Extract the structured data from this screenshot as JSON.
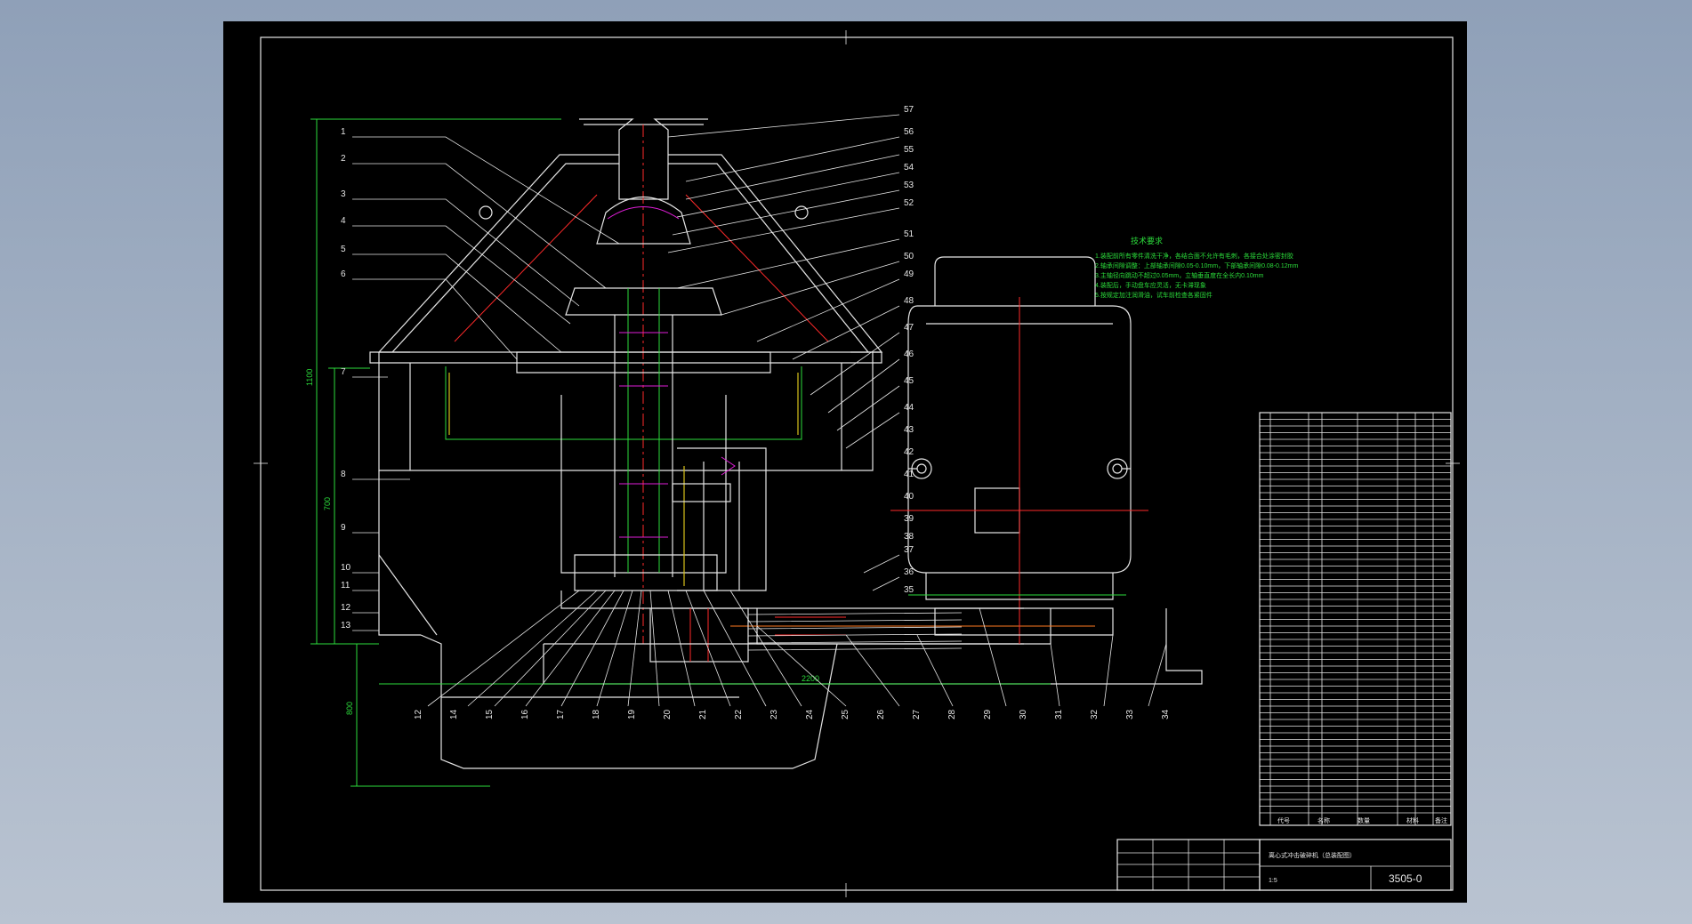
{
  "drawing": {
    "title": "",
    "drawing_number": "3505-0",
    "technical_notes_title": "技术要求",
    "technical_notes": [
      "1.装配前所有零件清洗干净，各结合面不允许有毛刺，各接合处涂密封胶",
      "2.轴承间隙调整：上部轴承间隙0.05-0.10mm，下部轴承间隙0.08-0.12mm",
      "3.主轴径向跳动不超过0.05mm，立轴垂直度在全长内0.10mm",
      "4.装配后，手动盘车应灵活，无卡滞现象",
      "5.按规定加注润滑油，试车前检查各紧固件"
    ],
    "callouts_left": [
      "1",
      "2",
      "3",
      "4",
      "5",
      "6",
      "7",
      "8",
      "9",
      "10",
      "11",
      "12",
      "13"
    ],
    "callouts_top_right": [
      "57",
      "56",
      "55",
      "54",
      "53",
      "52",
      "51",
      "50",
      "49",
      "48",
      "47",
      "46",
      "45",
      "44",
      "43",
      "42",
      "41",
      "40",
      "39",
      "38",
      "37",
      "36",
      "35"
    ],
    "callouts_bottom": [
      "12",
      "14",
      "15",
      "16",
      "17",
      "18",
      "19",
      "20",
      "21",
      "22",
      "23",
      "24",
      "25",
      "26",
      "27",
      "28",
      "29",
      "30",
      "31",
      "32",
      "33",
      "34"
    ],
    "dimension_labels": [
      "1100",
      "700",
      "2200",
      "800"
    ],
    "parts_list_rows": 60,
    "title_block": {
      "header_cols": [
        "代号",
        "名称",
        "数量",
        "材料",
        "备注"
      ],
      "name": "离心式冲击破碎机（总装配图）",
      "scale": "1:5",
      "number": "3505-0"
    }
  },
  "colors": {
    "background": "#000000",
    "outer_bg": "#a7b4c6",
    "line_white": "#e6e6e6",
    "line_green": "#2bdc3b",
    "line_red": "#ff2a2a",
    "line_magenta": "#e01ed8",
    "line_yellow": "#d8c21b"
  }
}
